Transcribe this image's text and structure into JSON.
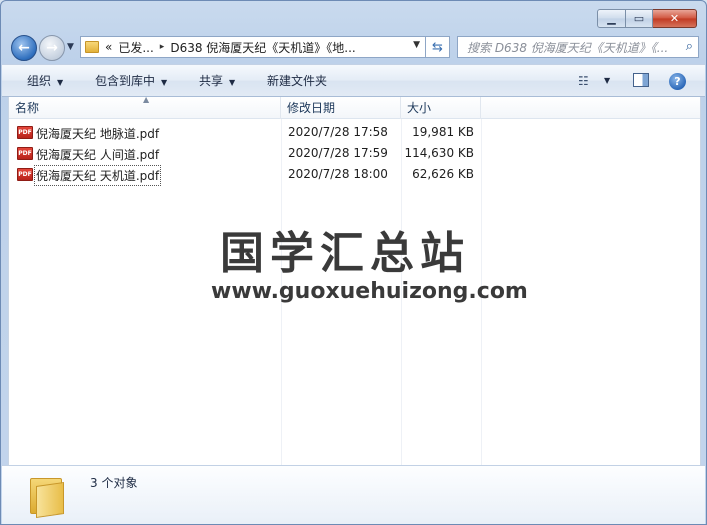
{
  "window": {
    "minimize_glyph": "▁",
    "maximize_glyph": "▭",
    "close_glyph": "✕"
  },
  "address_bar": {
    "overflow_chevron": "«",
    "crumbs": [
      "已发...",
      "D638 倪海厦天纪《天机道》《地..."
    ],
    "separator": "▸",
    "dropdown_glyph": "▼"
  },
  "search": {
    "placeholder": "搜索 D638 倪海厦天纪《天机道》《...",
    "icon": "search-icon"
  },
  "commands": {
    "organize": "组织",
    "include_in_library": "包含到库中",
    "share": "共享",
    "new_folder": "新建文件夹",
    "caret": "▼",
    "help": "?"
  },
  "columns": {
    "name": "名称",
    "date_modified": "修改日期",
    "size": "大小"
  },
  "files": [
    {
      "name": "倪海厦天纪 地脉道.pdf",
      "date": "2020/7/28 17:58",
      "size": "19,981 KB",
      "icon": "PDF"
    },
    {
      "name": "倪海厦天纪 人间道.pdf",
      "date": "2020/7/28 17:59",
      "size": "114,630 KB",
      "icon": "PDF"
    },
    {
      "name": "倪海厦天纪 天机道.pdf",
      "date": "2020/7/28 18:00",
      "size": "62,626 KB",
      "icon": "PDF"
    }
  ],
  "watermark": {
    "chinese": "国学汇总站",
    "url": "www.guoxuehuizong.com"
  },
  "details": {
    "item_count": "3 个对象"
  },
  "colors": {
    "frame": "#c3d5ec",
    "pdf_red": "#c8291f",
    "close_red": "#c13a22"
  }
}
